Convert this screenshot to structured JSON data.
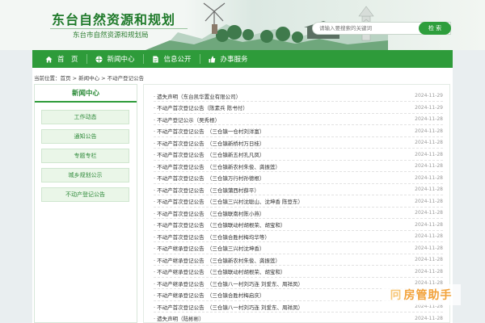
{
  "header": {
    "site_title": "东台自然资源和规划",
    "site_subtitle": "东台市自然资源和规划局",
    "search_placeholder": "请输入要搜索的关键词",
    "search_button": "检 索"
  },
  "nav": [
    {
      "label": "首　页",
      "icon": "home-icon"
    },
    {
      "label": "新闻中心",
      "icon": "globe-icon"
    },
    {
      "label": "信息公开",
      "icon": "document-icon"
    },
    {
      "label": "办事服务",
      "icon": "thumbs-up-icon"
    }
  ],
  "breadcrumb": "当前位置：首页 > 新闻中心 > 不动产登记公告",
  "sidebar": {
    "title": "新闻中心",
    "items": [
      {
        "label": "工作动态"
      },
      {
        "label": "通知公告"
      },
      {
        "label": "专题专栏"
      },
      {
        "label": "城乡规划公示"
      },
      {
        "label": "不动产登记公告"
      }
    ]
  },
  "list": [
    {
      "title": "· 遗失声明（东台凯华置业有限公司）",
      "date": "2024-11-29"
    },
    {
      "title": "· 不动产首次登记公告（陈素兵 陈书付）",
      "date": "2024-11-29"
    },
    {
      "title": "· 不动产登记公示（吴秀根）",
      "date": "2024-11-28"
    },
    {
      "title": "· 不动产首次登记公告　（三仓镇一仓村刘洋富）",
      "date": "2024-11-28"
    },
    {
      "title": "· 不动产首次登记公告　（三仓镇新桥村万日桂）",
      "date": "2024-11-28"
    },
    {
      "title": "· 不动产首次登记公告　（三仓镇新五村孔凡凤）",
      "date": "2024-11-28"
    },
    {
      "title": "· 不动产首次登记公告　（三仓镇新农村朱俊、龚振莲）",
      "date": "2024-11-28"
    },
    {
      "title": "· 不动产首次登记公告　（三仓镇万行村孙德根）",
      "date": "2024-11-28"
    },
    {
      "title": "· 不动产首次登记公告　（三仓镇蒲西村薛平）",
      "date": "2024-11-28"
    },
    {
      "title": "· 不动产首次登记公告　（三仓镇三兴村沈聪山、沈坤香 陈登东）",
      "date": "2024-11-28"
    },
    {
      "title": "· 不动产首次登记公告　（三仓镇联南村陈小燕）",
      "date": "2024-11-28"
    },
    {
      "title": "· 不动产首次登记公告　（三仓镇联动村胡根荣、胡宝和）",
      "date": "2024-11-28"
    },
    {
      "title": "· 不动产首次登记公告　（三仓镇合胜村梅均华等）",
      "date": "2024-11-28"
    },
    {
      "title": "· 不动产继承登记公告　（三仓镇三兴村沈坤香）",
      "date": "2024-11-28"
    },
    {
      "title": "· 不动产继承登记公告　（三仓镇新农村朱俊、龚振莲）",
      "date": "2024-11-28"
    },
    {
      "title": "· 不动产继承登记公告　（三仓镇联动村胡根荣、胡宝和）",
      "date": "2024-11-28"
    },
    {
      "title": "· 不动产继承登记公告　（三仓镇八一村刘巧连 刘爱东、周祥凤）",
      "date": "2024-11-28"
    },
    {
      "title": "· 不动产继承登记公告　（三仓镇合胜村梅启庆）",
      "date": "2024-11-28"
    },
    {
      "title": "· 不动产首次登记公告　（三仓镇八一村刘巧连 刘爱东、周祥凤）",
      "date": "2024-11-28"
    },
    {
      "title": "· 遗失声明（陆彬彬）",
      "date": "2024-11-28"
    }
  ],
  "watermark": {
    "glyph": "冋",
    "text": "房管助手"
  }
}
